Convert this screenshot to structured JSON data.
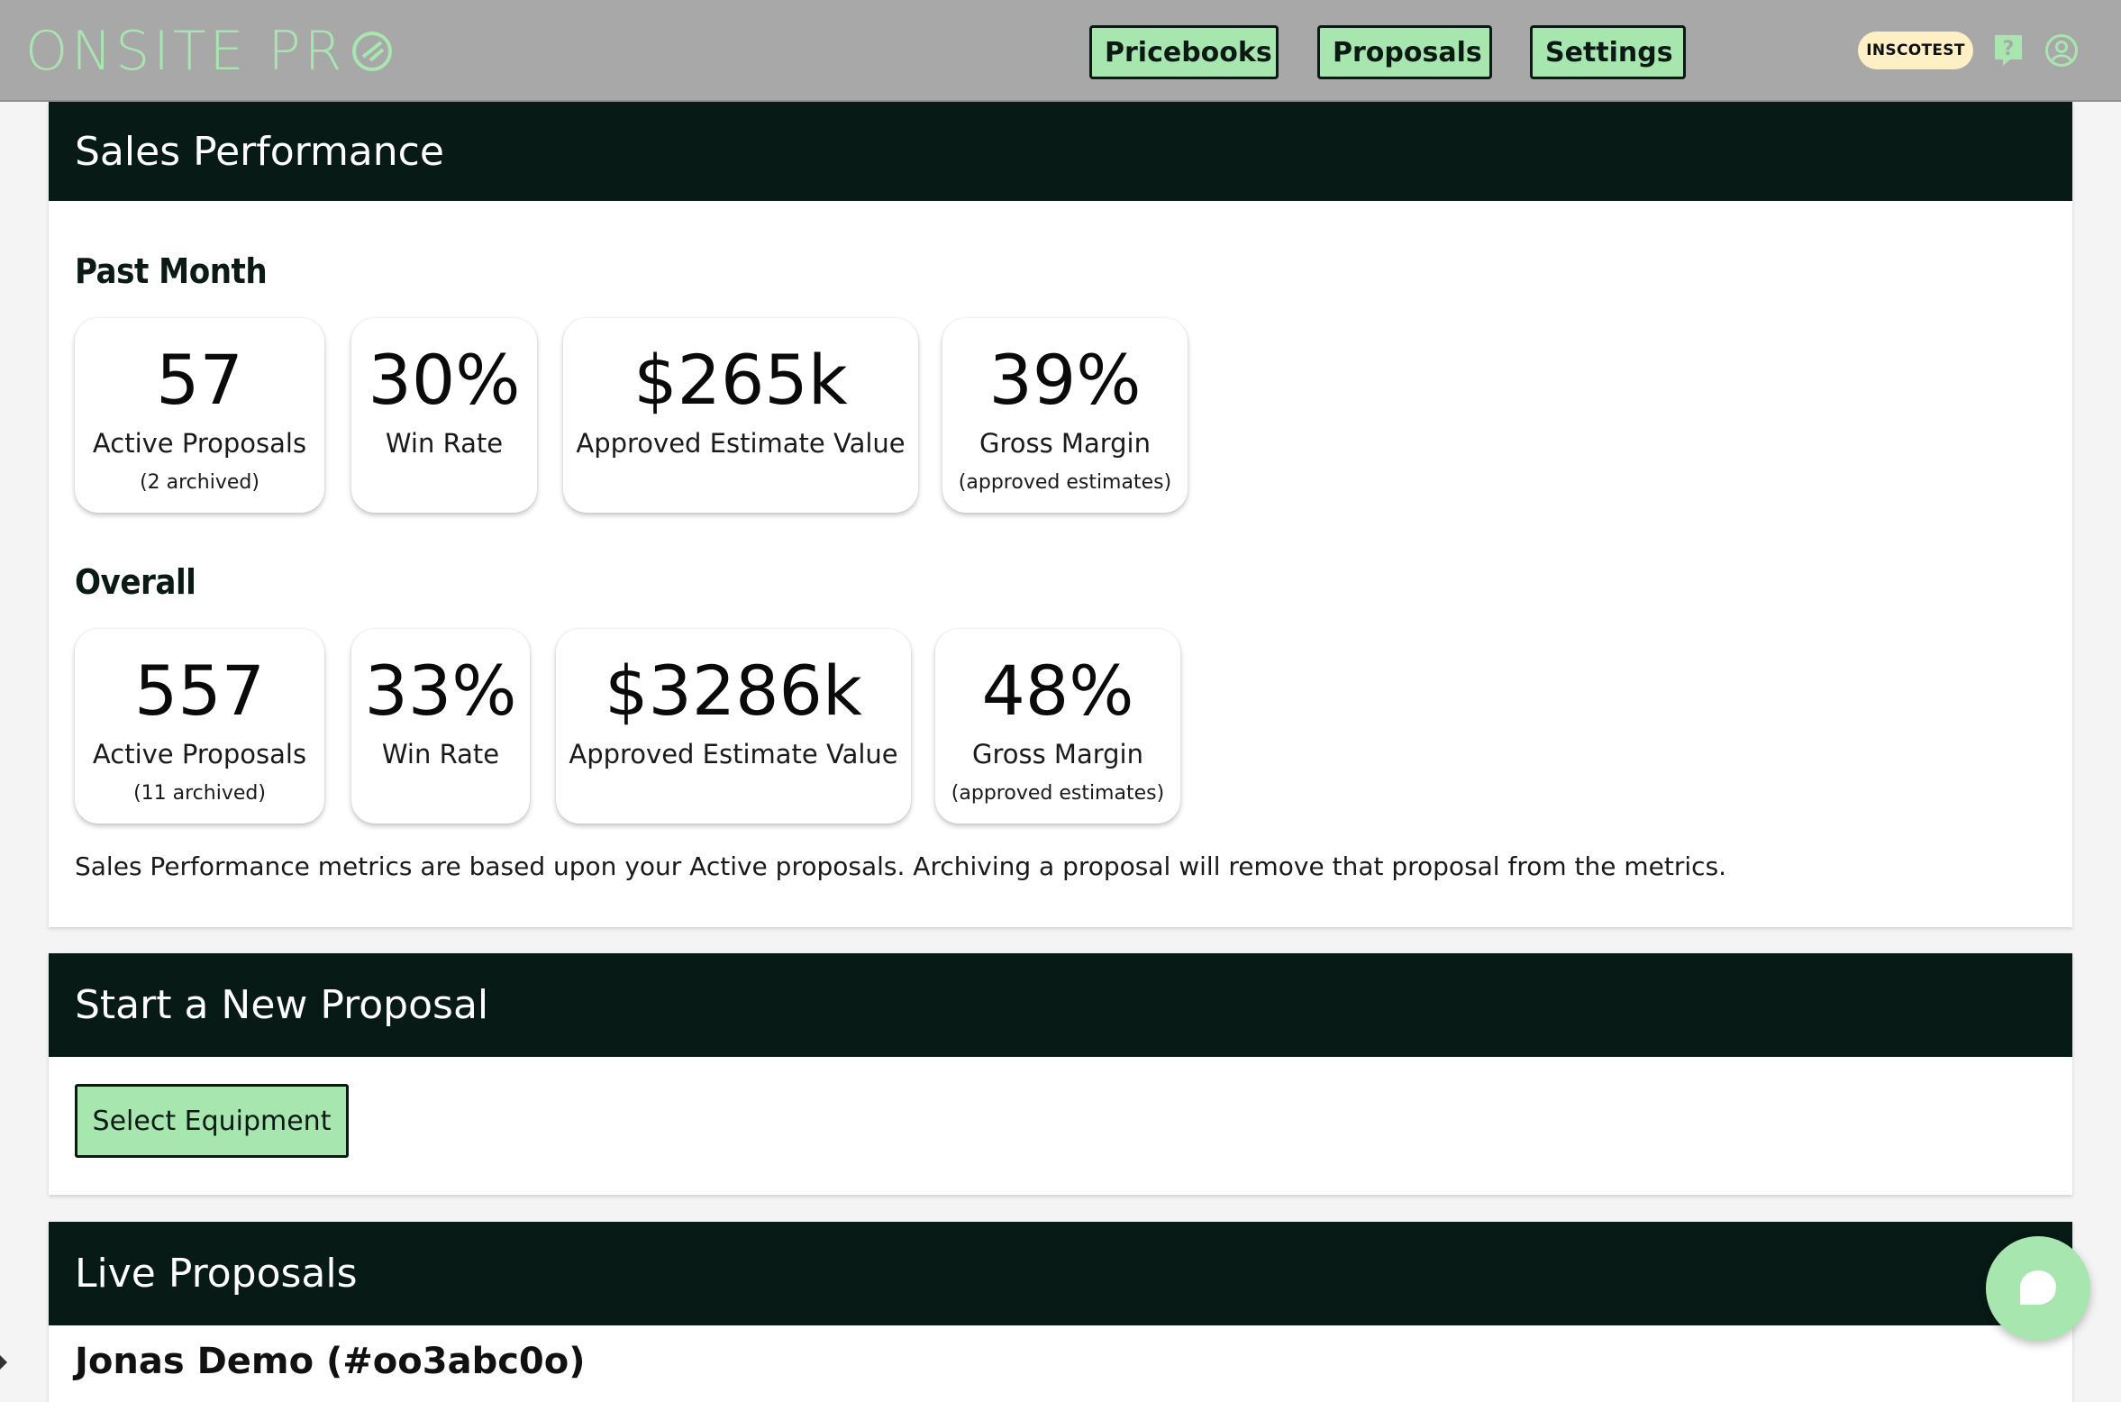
{
  "app": {
    "logo_text": "ONSITE PR",
    "brand_color": "#a8e6b0",
    "dark_color": "#071a16"
  },
  "nav": {
    "pricebooks": "Pricebooks",
    "proposals": "Proposals",
    "settings": "Settings",
    "account_badge": "INSCOTEST",
    "help_icon": "help-icon",
    "user_icon": "user-circle-icon"
  },
  "sales": {
    "title": "Sales Performance",
    "past_month": {
      "label": "Past Month",
      "metrics": [
        {
          "value": "57",
          "label": "Active Proposals",
          "sub": "(2 archived)"
        },
        {
          "value": "30%",
          "label": "Win Rate",
          "sub": ""
        },
        {
          "value": "$265k",
          "label": "Approved Estimate Value",
          "sub": ""
        },
        {
          "value": "39%",
          "label": "Gross Margin",
          "sub": "(approved estimates)"
        }
      ]
    },
    "overall": {
      "label": "Overall",
      "metrics": [
        {
          "value": "557",
          "label": "Active Proposals",
          "sub": "(11 archived)"
        },
        {
          "value": "33%",
          "label": "Win Rate",
          "sub": ""
        },
        {
          "value": "$3286k",
          "label": "Approved Estimate Value",
          "sub": ""
        },
        {
          "value": "48%",
          "label": "Gross Margin",
          "sub": "(approved estimates)"
        }
      ]
    },
    "note": "Sales Performance metrics are based upon your Active proposals. Archiving a proposal will remove that proposal from the metrics."
  },
  "new_proposal": {
    "title": "Start a New Proposal",
    "button": "Select Equipment"
  },
  "live": {
    "title": "Live Proposals",
    "first_row_partial": "Jonas Demo (#oo3abc0o)"
  }
}
